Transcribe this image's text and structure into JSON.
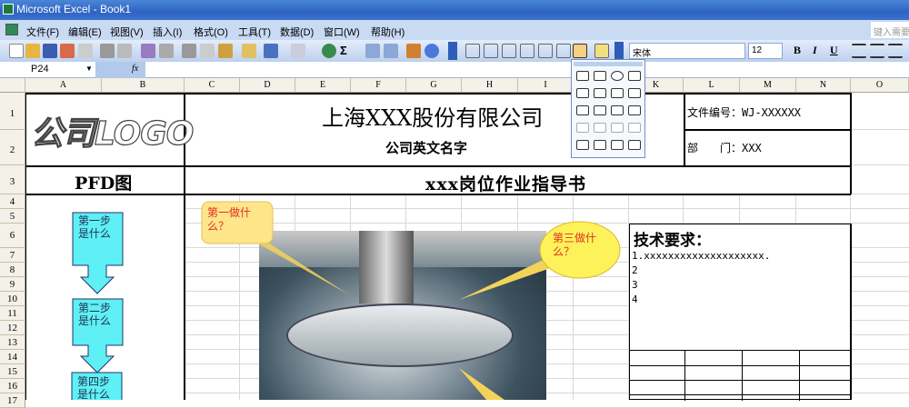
{
  "window": {
    "title": "Microsoft Excel - Book1"
  },
  "menubar": {
    "items": [
      "文件(F)",
      "编辑(E)",
      "视图(V)",
      "插入(I)",
      "格式(O)",
      "工具(T)",
      "数据(D)",
      "窗口(W)",
      "帮助(H)"
    ],
    "help_placeholder": "键入需要"
  },
  "toolbar": {
    "font": "宋体",
    "size": "12",
    "bold": "B",
    "italic": "I",
    "underline": "U"
  },
  "formula": {
    "namebox": "P24",
    "fx": "fx",
    "value": ""
  },
  "columns": [
    "A",
    "B",
    "C",
    "D",
    "E",
    "F",
    "G",
    "H",
    "I",
    "J",
    "K",
    "L",
    "M",
    "N",
    "O"
  ],
  "rows": [
    "1",
    "2",
    "3",
    "4",
    "5",
    "6",
    "7",
    "8",
    "9",
    "10",
    "11",
    "12",
    "13",
    "14",
    "15",
    "16",
    "17"
  ],
  "sheet": {
    "logo": "公司LOGO",
    "company": "上海XXX股份有限公司",
    "company_en": "公司英文名字",
    "doc_no": "文件编号：WJ-XXXXXX",
    "dept": "部　　门：XXX",
    "pfd": "PFD图",
    "doc_title": "xxx岗位作业指导书",
    "tech_title": "技术要求：",
    "tech_items": [
      "1.xxxxxxxxxxxxxxxxxxxx.",
      "2",
      "3",
      "4"
    ],
    "flow_steps": [
      "第一步是什么",
      "第二步是什么",
      "第四步是什么"
    ],
    "callouts": [
      "第一做什么？",
      "第三做什么？"
    ]
  }
}
